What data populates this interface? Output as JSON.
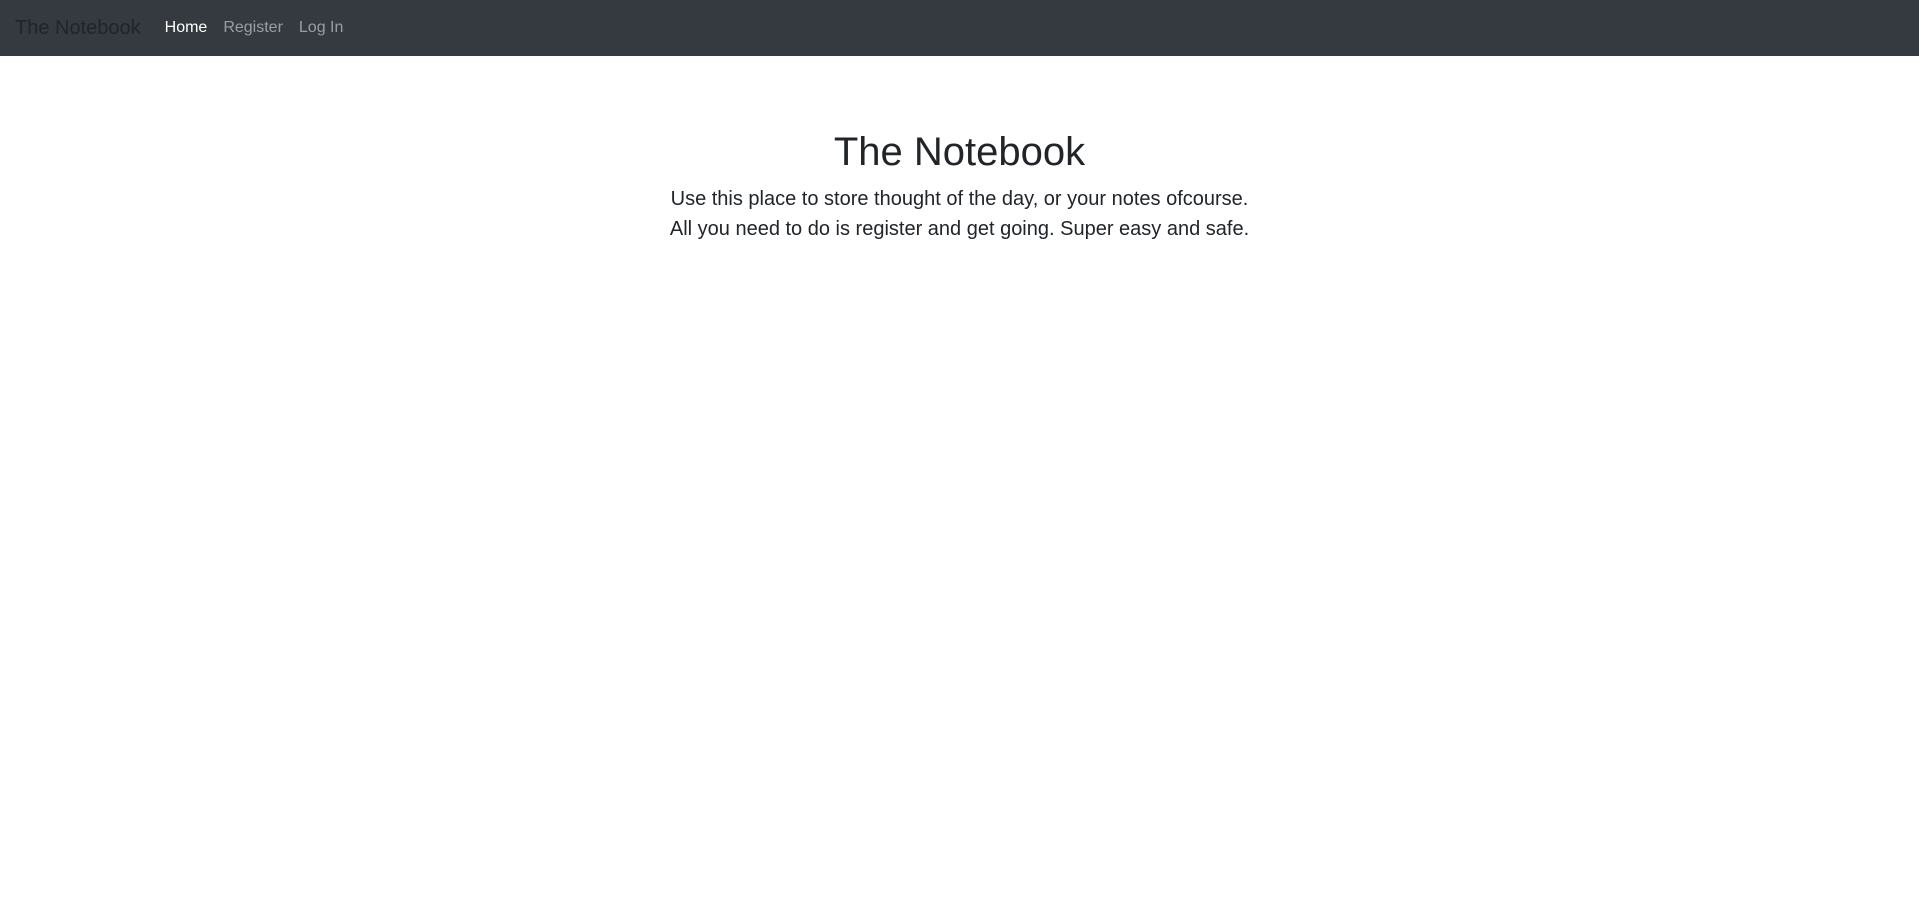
{
  "navbar": {
    "brand": "The Notebook",
    "links": [
      {
        "label": "Home",
        "active": true
      },
      {
        "label": "Register",
        "active": false
      },
      {
        "label": "Log In",
        "active": false
      }
    ]
  },
  "hero": {
    "title": "The Notebook",
    "lines": [
      "Use this place to store thought of the day, or your notes ofcourse.",
      "All you need to do is register and get going. Super easy and safe."
    ]
  },
  "colors": {
    "navbar_bg": "#343a40",
    "text": "#212529",
    "nav_active": "#ffffff",
    "nav_inactive": "#8e9296"
  }
}
